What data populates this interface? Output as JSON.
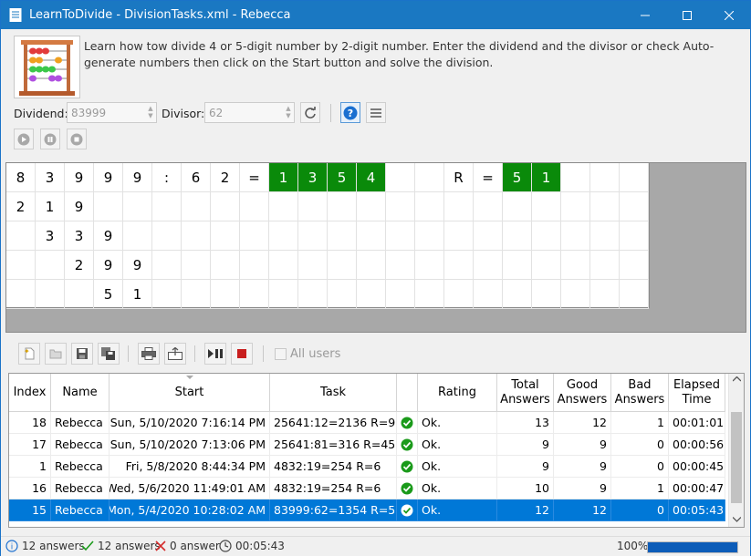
{
  "window": {
    "title": "LearnToDivide - DivisionTasks.xml - Rebecca"
  },
  "description": "Learn how tow divide 4 or 5-digit number by 2-digit number. Enter the dividend and the divisor or check Auto-generate numbers then click on the Start button and solve the division.",
  "inputs": {
    "dividend_label": "Dividend:",
    "dividend_value": "83999",
    "divisor_label": "Divisor:",
    "divisor_value": "62"
  },
  "division_grid": {
    "rows": [
      [
        "8",
        "3",
        "9",
        "9",
        "9",
        ":",
        "6",
        "2",
        "=",
        "1",
        "3",
        "5",
        "4",
        "",
        "",
        "R",
        "=",
        "5",
        "1",
        "",
        "",
        ""
      ],
      [
        "2",
        "1",
        "9",
        "",
        "",
        "",
        "",
        "",
        "",
        "",
        "",
        "",
        "",
        "",
        "",
        "",
        "",
        "",
        "",
        "",
        "",
        ""
      ],
      [
        "",
        "3",
        "3",
        "9",
        "",
        "",
        "",
        "",
        "",
        "",
        "",
        "",
        "",
        "",
        "",
        "",
        "",
        "",
        "",
        "",
        "",
        ""
      ],
      [
        "",
        "",
        "2",
        "9",
        "9",
        "",
        "",
        "",
        "",
        "",
        "",
        "",
        "",
        "",
        "",
        "",
        "",
        "",
        "",
        "",
        "",
        ""
      ],
      [
        "",
        "",
        "",
        "5",
        "1",
        "",
        "",
        "",
        "",
        "",
        "",
        "",
        "",
        "",
        "",
        "",
        "",
        "",
        "",
        "",
        "",
        ""
      ]
    ],
    "highlight_cols": [
      9,
      10,
      11,
      12,
      17,
      18
    ],
    "highlight_color": "#0a8a0a"
  },
  "toolbar2": {
    "all_users_label": "All users"
  },
  "table": {
    "columns": [
      "Index",
      "Name",
      "Start",
      "Task",
      "",
      "Rating",
      "Total Answers",
      "Good Answers",
      "Bad Answers",
      "Elapsed Time"
    ],
    "rows": [
      {
        "index": "18",
        "name": "Rebecca",
        "start": "Sun, 5/10/2020 7:16:14 PM",
        "task": "25641:12=2136 R=9",
        "rating": "Ok.",
        "total": "13",
        "good": "12",
        "bad": "1",
        "elapsed": "00:01:01"
      },
      {
        "index": "17",
        "name": "Rebecca",
        "start": "Sun, 5/10/2020 7:13:06 PM",
        "task": "25641:81=316 R=45",
        "rating": "Ok.",
        "total": "9",
        "good": "9",
        "bad": "0",
        "elapsed": "00:00:56"
      },
      {
        "index": "1",
        "name": "Rebecca",
        "start": "Fri, 5/8/2020 8:44:34 PM",
        "task": "4832:19=254 R=6",
        "rating": "Ok.",
        "total": "9",
        "good": "9",
        "bad": "0",
        "elapsed": "00:00:45"
      },
      {
        "index": "16",
        "name": "Rebecca",
        "start": "Wed, 5/6/2020 11:49:01 AM",
        "task": "4832:19=254 R=6",
        "rating": "Ok.",
        "total": "10",
        "good": "9",
        "bad": "1",
        "elapsed": "00:00:47"
      },
      {
        "index": "15",
        "name": "Rebecca",
        "start": "Mon, 5/4/2020 10:28:02 AM",
        "task": "83999:62=1354 R=51",
        "rating": "Ok.",
        "total": "12",
        "good": "12",
        "bad": "0",
        "elapsed": "00:05:43"
      }
    ],
    "selected_row": 4
  },
  "status": {
    "answers": "12 answers",
    "good": "12 answers",
    "bad": "0 answer",
    "time": "00:05:43",
    "zoom": "100%",
    "progress_percent": 100
  },
  "colors": {
    "titlebar": "#1a78c2",
    "selection": "#0078d7",
    "ok_green": "#1a9a1a"
  }
}
